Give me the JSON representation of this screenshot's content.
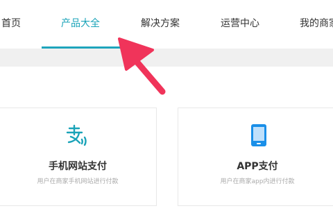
{
  "nav": {
    "items": [
      {
        "label": "首页"
      },
      {
        "label": "产品大全"
      },
      {
        "label": "解决方案"
      },
      {
        "label": "运营中心"
      },
      {
        "label": "我的商家"
      }
    ]
  },
  "cards": [
    {
      "title": "手机网站支付",
      "desc": "用户在商家手机网站进行付款",
      "icon": "alipay-logo-icon"
    },
    {
      "title": "APP支付",
      "desc": "用户在商家app内进行付款",
      "icon": "mobile-phone-icon"
    }
  ],
  "colors": {
    "accent": "#1aa3b8",
    "arrow": "#f0345a",
    "phone_icon": "#1a8fe8"
  }
}
